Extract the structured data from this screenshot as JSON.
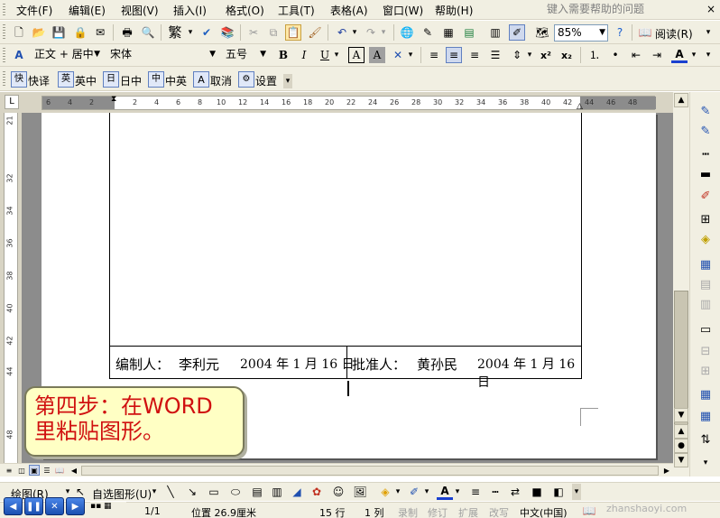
{
  "menubar": {
    "items": [
      "文件(F)",
      "编辑(E)",
      "视图(V)",
      "插入(I)",
      "格式(O)",
      "工具(T)",
      "表格(A)",
      "窗口(W)",
      "帮助(H)"
    ],
    "help_placeholder": "键入需要帮助的问题",
    "close_glyph": "×"
  },
  "standard_toolbar": {
    "zoom": "85%",
    "read_label": "阅读(R)",
    "fan_label": "繁"
  },
  "format_toolbar": {
    "style": "正文 + 居中",
    "font": "宋体",
    "size": "五号",
    "bold": "B",
    "italic": "I",
    "underline": "U",
    "superscript": "x²",
    "subscript": "x₂"
  },
  "translate_toolbar": {
    "items": [
      "快译",
      "英中",
      "日中",
      "中英",
      "取消",
      "设置"
    ]
  },
  "ruler": {
    "ticks": [
      "6",
      "4",
      "2",
      "",
      "2",
      "4",
      "6",
      "8",
      "10",
      "12",
      "14",
      "16",
      "18",
      "20",
      "22",
      "24",
      "26",
      "28",
      "30",
      "32",
      "34",
      "36",
      "38",
      "40",
      "42",
      "44",
      "46",
      "48"
    ]
  },
  "vruler": {
    "ticks": [
      "21",
      "32",
      "34",
      "36",
      "38",
      "40",
      "42",
      "44",
      "48"
    ]
  },
  "document": {
    "compiler_label": "编制人：",
    "compiler_name": "李利元",
    "compiler_date": "2004 年 1 月 16 日",
    "approver_label": "批准人：",
    "approver_name": "黄孙民",
    "approver_date": "2004 年 1 月 16 日"
  },
  "callout": {
    "line1": "第四步：在WORD",
    "line2": "里粘贴图形。"
  },
  "draw_toolbar": {
    "draw_label": "绘图(R)",
    "autoshape_label": "自选图形(U)"
  },
  "statusbar": {
    "page": "1/1",
    "position": "位置 26.9厘米",
    "line": "15 行",
    "col": "1 列",
    "rec": "录制",
    "trk": "修订",
    "ext": "扩展",
    "ovr": "改写",
    "lang": "中文(中国)"
  },
  "watermark": "zhanshaoyi.com",
  "colors": {
    "bar_bg": "#f1efe2",
    "callout_bg": "#ffffc4",
    "callout_text": "#d01010"
  }
}
